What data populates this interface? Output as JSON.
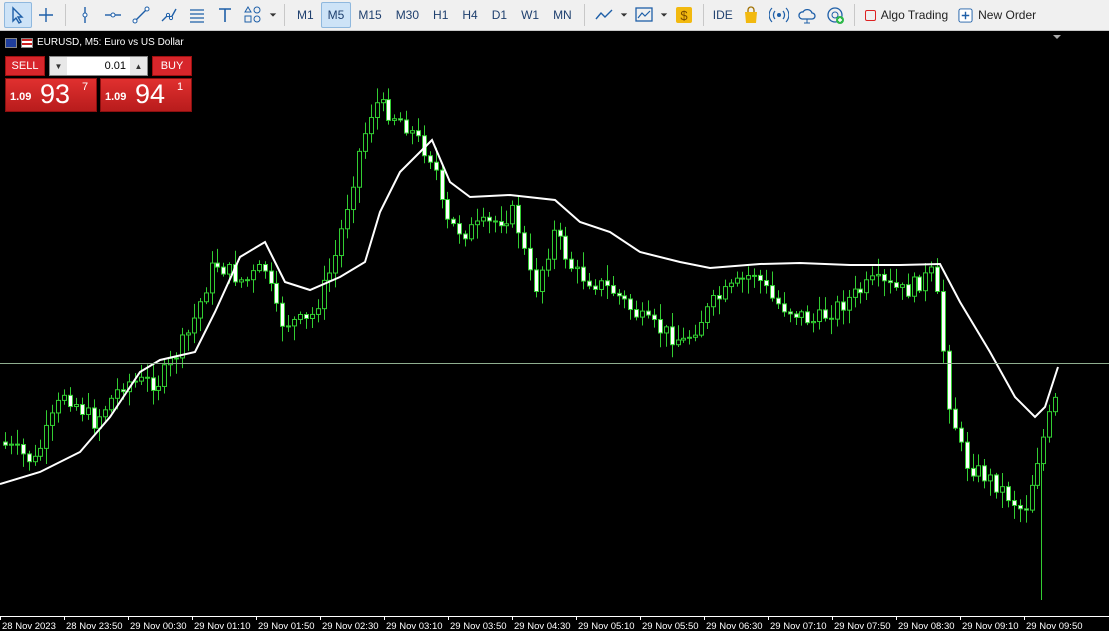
{
  "toolbar": {
    "timeframes": [
      "M1",
      "M5",
      "M15",
      "M30",
      "H1",
      "H4",
      "D1",
      "W1",
      "MN"
    ],
    "active_timeframe": "M5",
    "ide_label": "IDE",
    "algo_trading_label": "Algo Trading",
    "new_order_label": "New Order"
  },
  "chart": {
    "symbol_label": "EURUSD, M5: Euro vs US Dollar",
    "background": "#000000",
    "candle_color": "#32cd32",
    "ma_color": "#ffffff",
    "price_line_color": "#8fae8f"
  },
  "trade_panel": {
    "sell_label": "SELL",
    "buy_label": "BUY",
    "lot_value": "0.01",
    "sell_price": {
      "prefix": "1.09",
      "main": "93",
      "sup": "7"
    },
    "buy_price": {
      "prefix": "1.09",
      "main": "94",
      "sup": "1"
    }
  },
  "time_axis": {
    "labels": [
      "28 Nov 2023",
      "28 Nov 23:50",
      "29 Nov 00:30",
      "29 Nov 01:10",
      "29 Nov 01:50",
      "29 Nov 02:30",
      "29 Nov 03:10",
      "29 Nov 03:50",
      "29 Nov 04:30",
      "29 Nov 05:10",
      "29 Nov 05:50",
      "29 Nov 06:30",
      "29 Nov 07:10",
      "29 Nov 07:50",
      "29 Nov 08:30",
      "29 Nov 09:10",
      "29 Nov 09:50"
    ]
  }
}
